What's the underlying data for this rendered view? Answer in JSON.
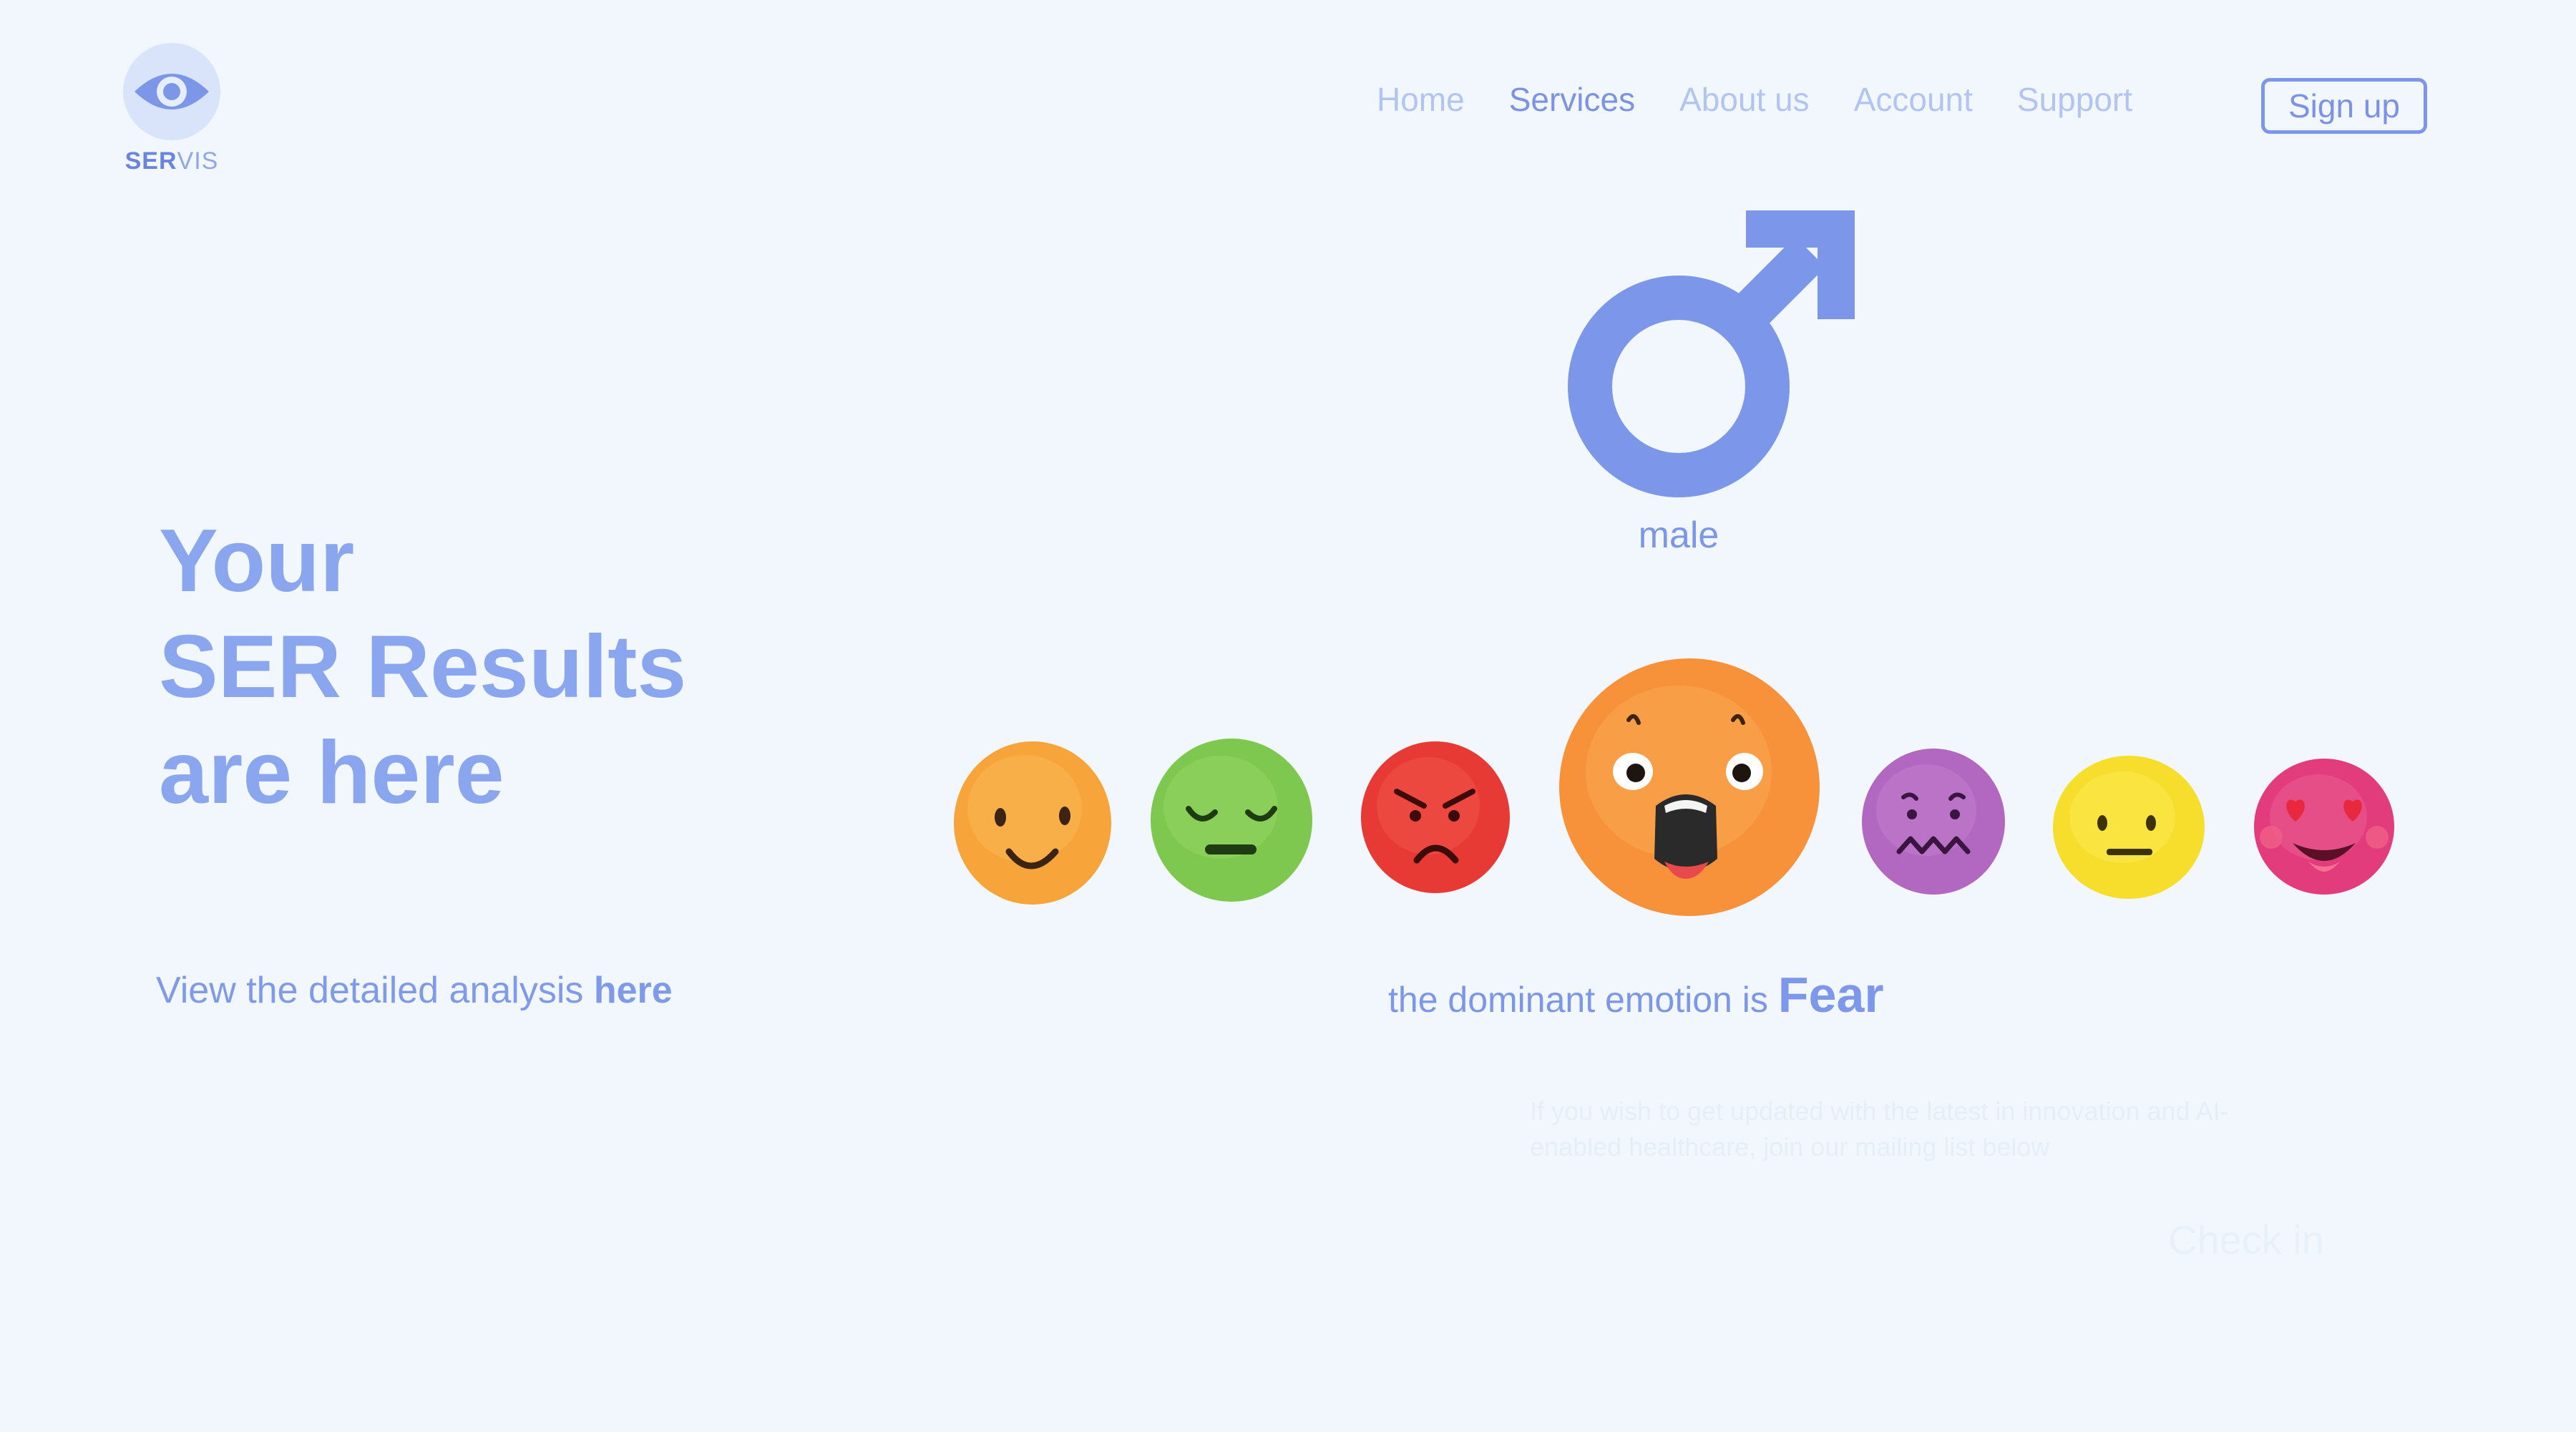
{
  "brand": {
    "name_bold": "SER",
    "name_light": "VIS"
  },
  "nav": {
    "items": [
      {
        "label": "Home",
        "active": false
      },
      {
        "label": "Services",
        "active": true
      },
      {
        "label": "About us",
        "active": false
      },
      {
        "label": "Account",
        "active": false
      },
      {
        "label": "Support",
        "active": false
      }
    ],
    "signup_label": "Sign up"
  },
  "hero": {
    "line1": "Your",
    "line2": "SER Results",
    "line3": "are here"
  },
  "analysis": {
    "prefix": "View the detailed analysis ",
    "link": "here"
  },
  "gender": {
    "icon": "male-symbol-icon",
    "label": "male"
  },
  "emotions": [
    {
      "icon": "happy-emoji-icon",
      "color": "#f7a53a"
    },
    {
      "icon": "sad-emoji-icon",
      "color": "#7ec84f"
    },
    {
      "icon": "angry-emoji-icon",
      "color": "#e83a34"
    },
    {
      "icon": "fear-emoji-icon",
      "color": "#f7913a",
      "dominant": true
    },
    {
      "icon": "disgust-emoji-icon",
      "color": "#b267c0"
    },
    {
      "icon": "neutral-emoji-icon",
      "color": "#f7de2c"
    },
    {
      "icon": "love-emoji-icon",
      "color": "#e23c7c"
    }
  ],
  "result": {
    "prefix": "the dominant emotion is ",
    "emotion": "Fear"
  },
  "footer": {
    "mailing_text": "If you wish to get updated with the latest in innovation and AI-enabled healthcare, join our mailing list below",
    "checkin_label": "Check in"
  },
  "colors": {
    "background": "#f1f7fc",
    "accent": "#7c96e8"
  }
}
